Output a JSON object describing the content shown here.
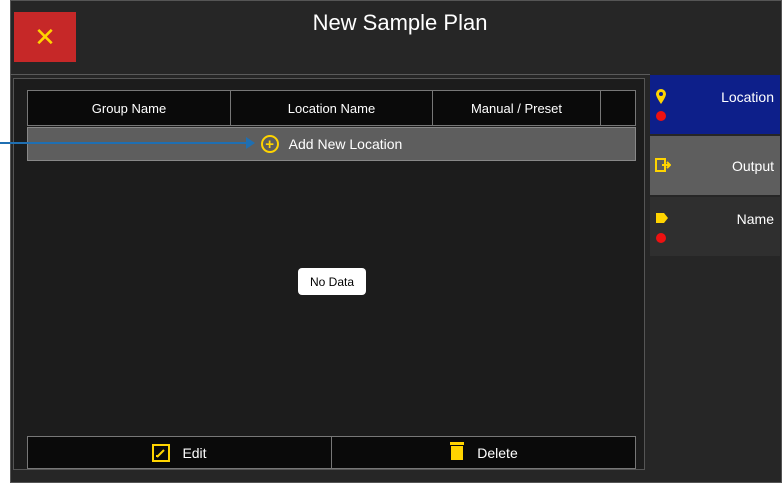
{
  "title": "New Sample Plan",
  "table": {
    "columns": [
      "Group Name",
      "Location Name",
      "Manual / Preset"
    ],
    "add_row_label": "Add New Location",
    "empty_text": "No Data"
  },
  "footer": {
    "edit_label": "Edit",
    "delete_label": "Delete"
  },
  "sidebar": {
    "items": [
      {
        "label": "Location",
        "icon": "location-pin-icon",
        "active": true,
        "status": "red-dot"
      },
      {
        "label": "Output",
        "icon": "output-icon",
        "active": false
      },
      {
        "label": "Name",
        "icon": "tag-icon",
        "active": false,
        "status": "red-dot"
      }
    ]
  },
  "colors": {
    "close_bg": "#c62828",
    "accent_yellow": "#ffd400",
    "active_tab": "#0d1f8a",
    "output_tab": "#5e5e5e",
    "name_tab": "#2f2f2f",
    "status_red": "#e11111",
    "callout_blue": "#1f6fb2"
  }
}
